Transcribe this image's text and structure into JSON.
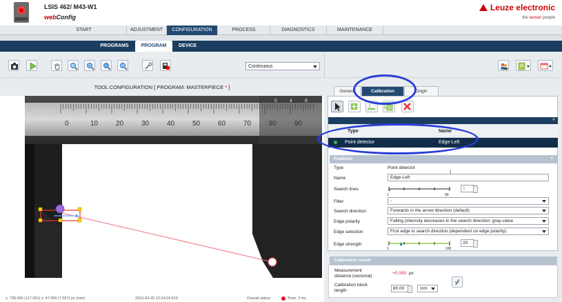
{
  "header": {
    "device_title": "LSIS 462/ M43-W1",
    "app_name_prefix": "web",
    "app_name_suffix": "Config",
    "brand": "Leuze electronic",
    "tagline_prefix": "the ",
    "tagline_highlight": "sensor",
    "tagline_suffix": " people"
  },
  "main_nav": [
    "START",
    "ADJUSTMENT",
    "CONFIGURATION",
    "PROCESS",
    "DIAGNOSTICS",
    "MAINTENANCE"
  ],
  "main_nav_active": "CONFIGURATION",
  "sub_nav": [
    "PROGRAMS",
    "PROGRAM",
    "DEVICE"
  ],
  "sub_nav_active": "PROGRAM",
  "toolbar": {
    "mode_select_value": "Continuous",
    "icons": [
      "camera-icon",
      "play-icon",
      "hand-icon",
      "zoom-in-icon",
      "zoom-out-icon",
      "zoom-fit-icon",
      "zoom-actual-icon",
      "wrench-icon",
      "save-to-device-icon"
    ],
    "right_icons": [
      "users-icon",
      "layout-icon",
      "display-mode-icon"
    ]
  },
  "tool_config": {
    "title_prefix": "TOOL CONFIGURATION   [ PROGRAM: MASTERPIECE ",
    "title_star": "*",
    "title_suffix": " ]"
  },
  "ruler": {
    "numbers": [
      "0",
      "10",
      "20",
      "30",
      "40",
      "50",
      "60",
      "70",
      "80",
      "90"
    ],
    "top_numbers": [
      "0",
      "4",
      "8"
    ]
  },
  "status": {
    "coords": "x: 728.000 (117.061) y: 47.000 (7.557) px (mm)",
    "timestamp": "2013-04-25 12:24:24.819",
    "overall_label": "Overall status:",
    "time_label": "Time: 2 ms"
  },
  "right_panel": {
    "tabs": [
      "General",
      "Calibration",
      "Origin"
    ],
    "active_tab": "Calibration",
    "tool_icons": [
      "cursor-icon",
      "add-tool-icon",
      "add-edge-icon",
      "duplicate-icon",
      "delete-icon"
    ],
    "list": {
      "col_type": "Type",
      "col_name": "Name",
      "rows": [
        {
          "type": "Point detector",
          "name": "Edge-Left"
        }
      ]
    },
    "features": {
      "section": "Features",
      "type_label": "Type",
      "type_value": "Point detector",
      "name_label": "Name",
      "name_value": "Edge-Left",
      "search_lines_label": "Search lines",
      "search_lines_min": "1",
      "search_lines_max": "99",
      "search_lines_value": "1",
      "filter_label": "Filter",
      "filter_value": "-",
      "search_direction_label": "Search direction",
      "search_direction_value": "Forwards in the arrow direction (default)",
      "edge_polarity_label": "Edge polarity",
      "edge_polarity_value": "Falling (intensity decreases in the search direction: gray-value",
      "edge_selection_label": "Edge selection",
      "edge_selection_value": "First edge in search direction (dependent on edge polarity)",
      "edge_strength_label": "Edge strength",
      "edge_strength_min": "1",
      "edge_strength_max": "100",
      "edge_strength_value": "20",
      "edge_strength_fraction": 0.2
    },
    "calibration_result": {
      "section": "Calibration result",
      "measurement_label_1": "Measurement",
      "measurement_label_2": "distance (vectorial)",
      "measurement_value": "+0.000",
      "measurement_unit": "px",
      "block_label_1": "Calibration block",
      "block_label_2": "length",
      "block_value": "80.00",
      "block_unit": "mm"
    }
  },
  "colors": {
    "brand_red": "#cc0000",
    "nav_dark": "#1b3d60",
    "nav_active": "#234a72",
    "highlight_ellipse": "#2a3fd6",
    "roi_line": "#f07080"
  }
}
